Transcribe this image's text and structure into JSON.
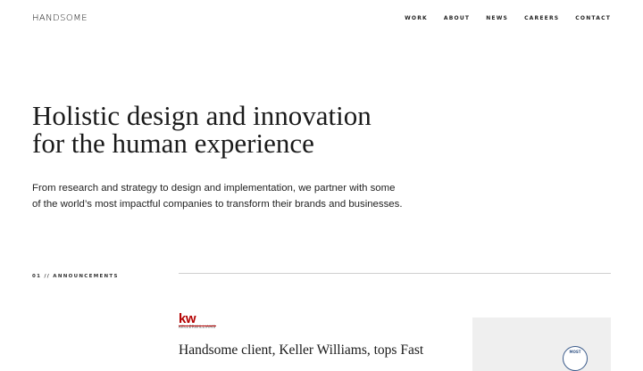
{
  "header": {
    "logo": "HANDSOME",
    "nav": [
      "Work",
      "About",
      "News",
      "Careers",
      "Contact"
    ]
  },
  "hero": {
    "title_line1": "Holistic design and innovation",
    "title_line2": "for the human experience",
    "subtitle_line1": "From research and strategy to design and implementation, we partner with some",
    "subtitle_line2": "of the world’s most impactful companies to transform their brands and businesses."
  },
  "announcements": {
    "label": "01 // Announcements",
    "item": {
      "logo_mark": "kw",
      "logo_text": "KELLERWILLIAMS",
      "headline": "Handsome client, Keller Williams, tops Fast",
      "badge_text": "MOST"
    }
  },
  "colors": {
    "background": "#ffffff",
    "text": "#1a1a1a",
    "brand_kw": "#b40101",
    "divider": "#cfcfcf",
    "image_bg": "#efefef"
  }
}
